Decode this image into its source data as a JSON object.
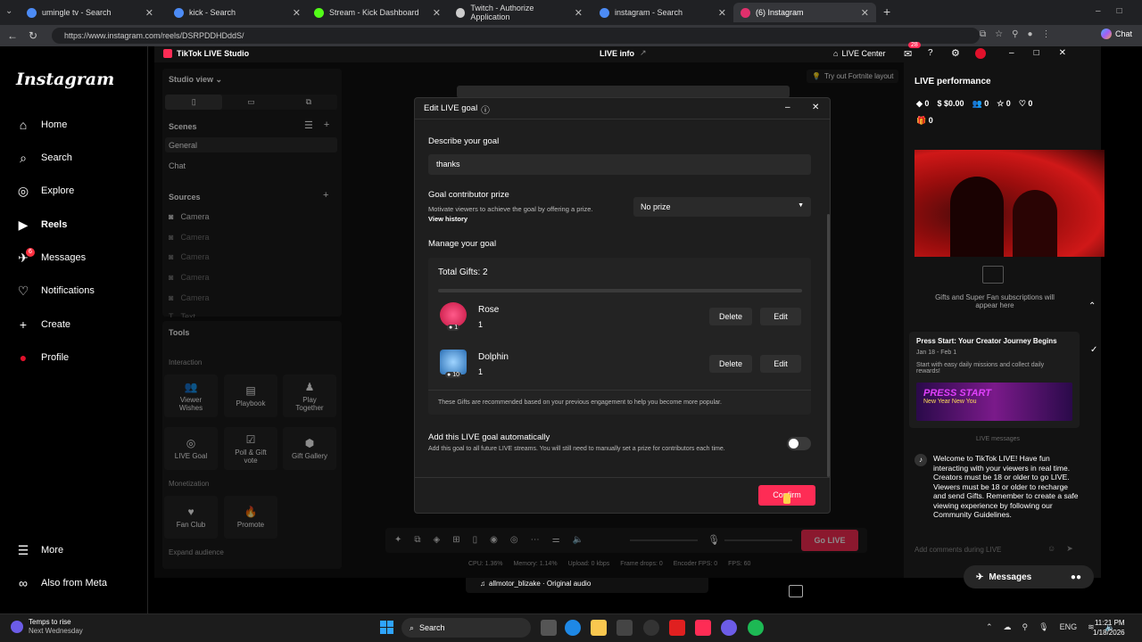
{
  "browser": {
    "tabs": [
      {
        "title": "umingle tv - Search",
        "color": "#4c8bf5"
      },
      {
        "title": "kick - Search",
        "color": "#4c8bf5"
      },
      {
        "title": "Stream - Kick Dashboard",
        "color": "#53fc18"
      },
      {
        "title": "Twitch - Authorize Application",
        "color": "#cccccc"
      },
      {
        "title": "instagram - Search",
        "color": "#4c8bf5"
      },
      {
        "title": "(6) Instagram",
        "color": "#e1306c"
      }
    ],
    "new_tab": "+",
    "url": "https://www.instagram.com/reels/DSRPDDHDddS/",
    "chat_label": "Chat"
  },
  "instagram": {
    "logo": "Instagram",
    "nav": [
      {
        "label": "Home",
        "icon": "home-icon",
        "glyph": "⌂"
      },
      {
        "label": "Search",
        "icon": "search-icon",
        "glyph": "⌕"
      },
      {
        "label": "Explore",
        "icon": "compass-icon",
        "glyph": "◎"
      },
      {
        "label": "Reels",
        "icon": "reels-icon",
        "glyph": "▶"
      },
      {
        "label": "Messages",
        "icon": "messenger-icon",
        "glyph": "✈"
      },
      {
        "label": "Notifications",
        "icon": "heart-icon",
        "glyph": "♡"
      },
      {
        "label": "Create",
        "icon": "plus-icon",
        "glyph": "+"
      },
      {
        "label": "Profile",
        "icon": "avatar-icon",
        "glyph": "●"
      }
    ],
    "messages_badge": "6",
    "more": "More",
    "also_from_meta": "Also from Meta"
  },
  "studio": {
    "title": "TikTok LIVE Studio",
    "live_info": "LIVE info",
    "live_center": "LIVE Center",
    "notif_badge": "28",
    "studio_view": "Studio view",
    "scenes_label": "Scenes",
    "scenes": [
      "General",
      "Chat"
    ],
    "sources_label": "Sources",
    "sources": [
      "Camera",
      "Camera",
      "Camera",
      "Camera",
      "Camera",
      "Text"
    ],
    "tools_label": "Tools",
    "interaction_label": "Interaction",
    "interaction_tools": [
      "Viewer Wishes",
      "Playbook",
      "Play Together",
      "LIVE Goal",
      "Poll & Gift vote",
      "Gift Gallery"
    ],
    "monetization_label": "Monetization",
    "monetization_tools": [
      "Fan Club",
      "Promote"
    ],
    "expand_audience": "Expand audience",
    "fortnite_tip": "Try out Fortnite layout",
    "go_live": "Go LIVE",
    "music": "allmotor_blizake · Original audio",
    "stats": {
      "cpu": "CPU: 1.36%",
      "memory": "Memory: 1.14%",
      "upload": "Upload: 0 kbps",
      "frame_drops": "Frame drops: 0",
      "encoder_fps": "Encoder FPS: 0",
      "fps": "FPS: 60"
    }
  },
  "modal": {
    "title": "Edit LIVE goal",
    "describe_label": "Describe your goal",
    "describe_value": "thanks",
    "prize_label": "Goal contributor prize",
    "prize_desc": "Motivate viewers to achieve the goal by offering a prize.",
    "view_history": "View history",
    "prize_value": "No prize",
    "manage_label": "Manage your goal",
    "total_gifts": "Total Gifts: 2",
    "gifts": [
      {
        "name": "Rose",
        "count": "1",
        "cost": "1",
        "color": "#e8265e",
        "delete": "Delete",
        "edit": "Edit"
      },
      {
        "name": "Dolphin",
        "count": "1",
        "cost": "10",
        "color": "#4fa3e0",
        "delete": "Delete",
        "edit": "Edit"
      }
    ],
    "recommend_note": "These Gifts are recommended based on your previous engagement to help you become more popular.",
    "auto_label": "Add this LIVE goal automatically",
    "auto_desc": "Add this goal to all future LIVE streams. You will still need to manually set a prize for contributors each time.",
    "confirm": "Confirm"
  },
  "performance": {
    "title": "LIVE performance",
    "stats": [
      "0",
      "$0.00",
      "0",
      "0",
      "0"
    ],
    "gift_count": "0",
    "gifts_note": "Gifts and Super Fan subscriptions will appear here",
    "promo_title": "Press Start: Your Creator Journey Begins",
    "promo_date": "Jan 18 - Feb 1",
    "promo_desc": "Start with easy daily missions and collect daily rewards!",
    "promo_banner": "PRESS START",
    "promo_sub": "New Year New You",
    "live_messages_label": "LIVE messages",
    "welcome": "Welcome to TikTok LIVE! Have fun interacting with your viewers in real time. Creators must be 18 or older to go LIVE. Viewers must be 18 or older to recharge and send Gifts. Remember to create a safe viewing experience by following our Community Guidelines.",
    "comment_placeholder": "Add comments during LIVE",
    "messages_float": "Messages"
  },
  "taskbar": {
    "weather_title": "Temps to rise",
    "weather_sub": "Next Wednesday",
    "search": "Search",
    "lang": "ENG",
    "time": "11:21 PM",
    "date": "1/18/2026"
  }
}
